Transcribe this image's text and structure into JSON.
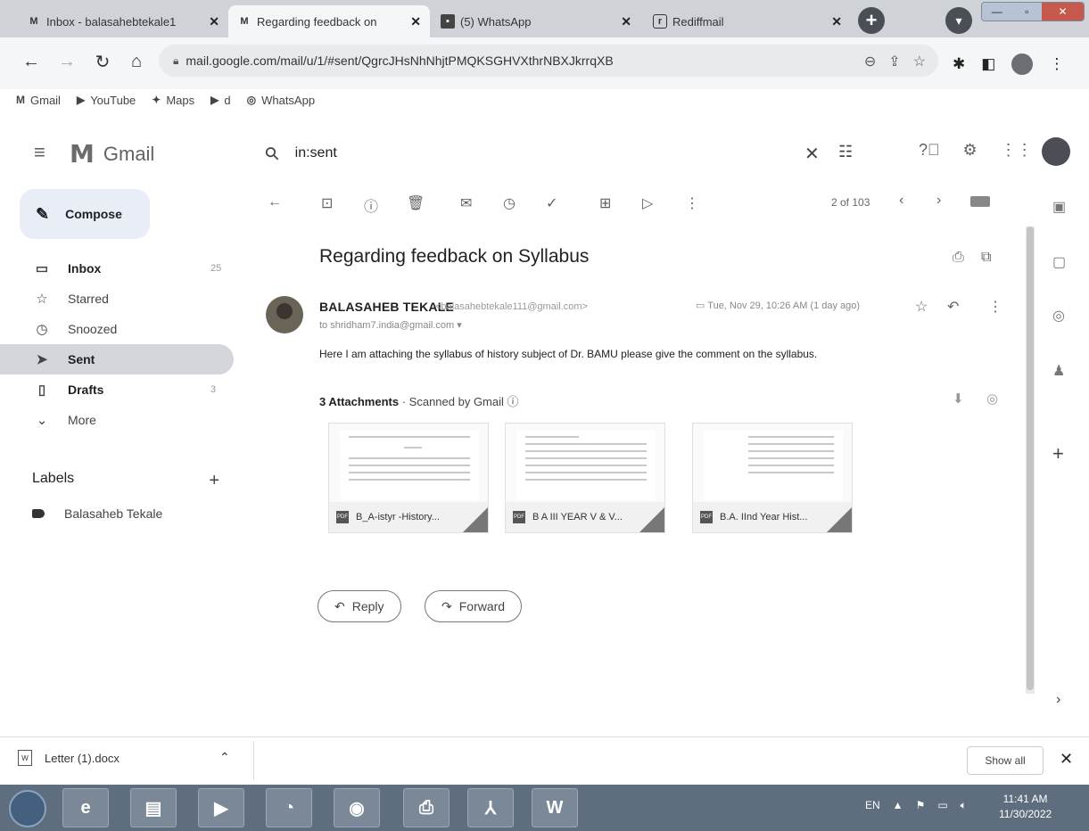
{
  "browser": {
    "tabs": [
      {
        "icon": "gmail-icon",
        "title": "Inbox - balasahebtekale1"
      },
      {
        "icon": "gmail-icon",
        "title": "Regarding feedback on"
      },
      {
        "icon": "whatsapp-icon",
        "title": "(5) WhatsApp"
      },
      {
        "icon": "rediffmail-icon",
        "title": "Rediffmail"
      }
    ],
    "url": "mail.google.com/mail/u/1/#sent/QgrcJHsNhNhjtPMQKSGHVXthrNBXJkrrqXB",
    "bookmarks": [
      "Gmail",
      "YouTube",
      "Maps",
      "d",
      "WhatsApp"
    ]
  },
  "gmail": {
    "logo_text": "Gmail",
    "search_value": "in:sent",
    "compose_label": "Compose",
    "nav": [
      {
        "icon": "inbox-icon",
        "label": "Inbox",
        "count": "25"
      },
      {
        "icon": "star-icon",
        "label": "Starred",
        "count": ""
      },
      {
        "icon": "clock-icon",
        "label": "Snoozed",
        "count": ""
      },
      {
        "icon": "send-icon",
        "label": "Sent",
        "count": ""
      },
      {
        "icon": "draft-icon",
        "label": "Drafts",
        "count": "3"
      },
      {
        "icon": "chevron-down-icon",
        "label": "More",
        "count": ""
      }
    ],
    "labels_heading": "Labels",
    "labels": [
      "Balasaheb Tekale"
    ],
    "pager": "2 of 103"
  },
  "message": {
    "subject": "Regarding feedback on Syllabus",
    "sender_name": "BALASAHEB TEKALE",
    "sender_email": "<balasahebtekale111@gmail.com>",
    "to": "to shridham7.india@gmail.com",
    "date": "Tue, Nov 29, 10:26 AM (1 day ago)",
    "body": "Here I am attaching the syllabus of history subject of Dr. BAMU please give the comment on the syllabus.",
    "attachments_count": "3 Attachments",
    "scanned": "· Scanned by Gmail",
    "attachments": [
      {
        "name": "B_A-istyr -History..."
      },
      {
        "name": "B A III YEAR V & V..."
      },
      {
        "name": "B.A. IInd Year Hist..."
      }
    ],
    "reply_label": "Reply",
    "forward_label": "Forward"
  },
  "downloads": {
    "file": "Letter (1).docx",
    "show_all": "Show all"
  },
  "taskbar": {
    "lang": "EN",
    "time": "11:41 AM",
    "date": "11/30/2022"
  }
}
